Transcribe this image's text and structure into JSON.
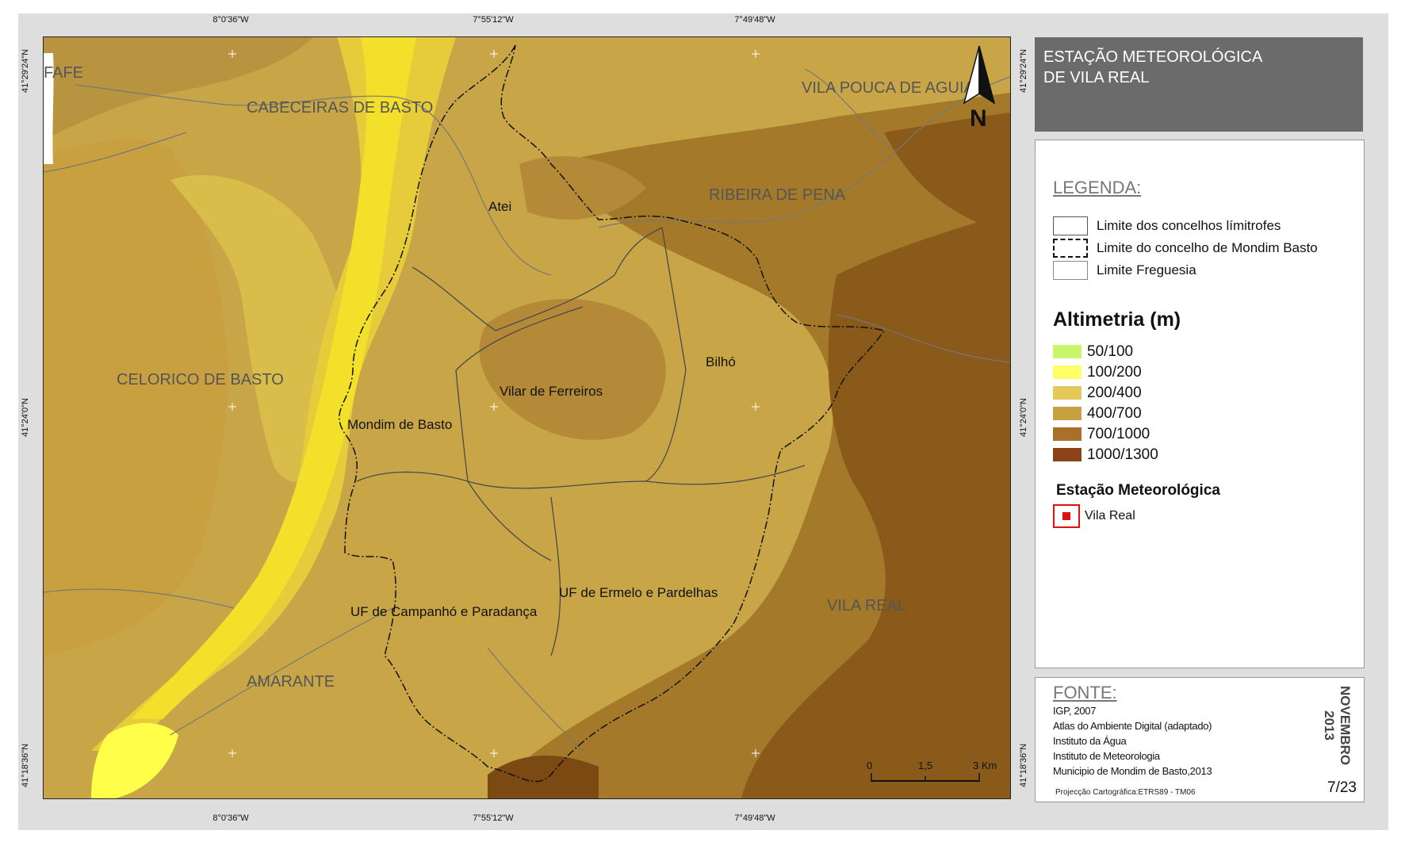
{
  "coordinates": {
    "top": [
      "8°0'36\"W",
      "7°55'12\"W",
      "7°49'48\"W"
    ],
    "bottom": [
      "8°0'36\"W",
      "7°55'12\"W",
      "7°49'48\"W"
    ],
    "left": [
      "41°29'24\"N",
      "41°24'0\"N",
      "41°18'36\"N"
    ],
    "right": [
      "41°29'24\"N",
      "41°24'0\"N",
      "41°18'36\"N"
    ]
  },
  "map": {
    "concelhos": [
      "FAFE",
      "CABECEIRAS DE BASTO",
      "VILA POUCA DE AGUIAR",
      "RIBEIRA DE PENA",
      "CELORICO DE BASTO",
      "AMARANTE",
      "VILA REAL"
    ],
    "freguesias": [
      "Atei",
      "Bilhó",
      "Vilar de Ferreiros",
      "Mondim de Basto",
      "UF de Campanhó e Paradança",
      "UF de Ermelo e Pardelhas"
    ],
    "north_label": "N",
    "scale": {
      "zero": "0",
      "mid": "1,5",
      "end": "3 Km"
    }
  },
  "title": {
    "line1": "ESTAÇÃO METEOROLÓGICA",
    "line2": "DE VILA REAL"
  },
  "legend": {
    "title": "LEGENDA:",
    "limits": [
      "Limite dos concelhos límitrofes",
      "Limite do concelho de Mondim Basto",
      "Limite Freguesia"
    ],
    "altimetry_title": "Altimetria (m)",
    "altimetry": [
      {
        "label": "50/100",
        "color": "#c8f56a"
      },
      {
        "label": "100/200",
        "color": "#ffff66"
      },
      {
        "label": "200/400",
        "color": "#e4c95a"
      },
      {
        "label": "400/700",
        "color": "#c8a040"
      },
      {
        "label": "700/1000",
        "color": "#a8702a"
      },
      {
        "label": "1000/1300",
        "color": "#8a4418"
      }
    ],
    "station_title": "Estação Meteorológica",
    "station_label": "Vila Real"
  },
  "source": {
    "title": "FONTE:",
    "lines": [
      "IGP, 2007",
      "Atlas do Ambiente Digital (adaptado)",
      "Instituto da Água",
      "Instituto de Meteorologia",
      "Municipio de Mondim de Basto,2013"
    ],
    "projection": "Projecção Cartográfica:ETRS89 - TM06",
    "date_line1": "NOVEMBRO",
    "date_line2": "2013",
    "page": "7/23"
  }
}
